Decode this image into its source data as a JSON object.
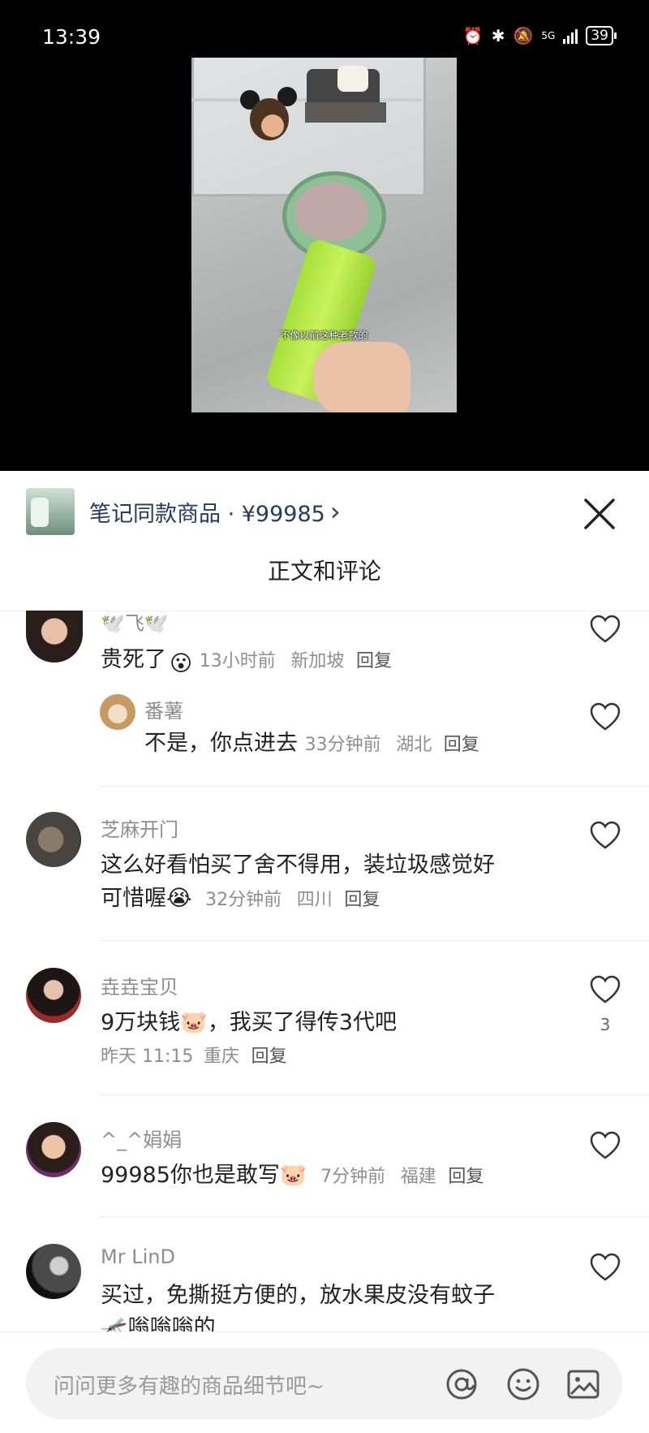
{
  "status_bar": {
    "time": "13:39",
    "battery": "39",
    "network": "5G"
  },
  "video": {
    "subtitle": "不像以前这种老款的"
  },
  "goods_banner": {
    "label": "笔记同款商品 · ¥99985",
    "chevron": "›"
  },
  "sheet": {
    "title": "正文和评论"
  },
  "comments": [
    {
      "name": "🕊️飞🕊️",
      "text": "贵死了",
      "emoji": "😮",
      "time": "13小时前",
      "location": "新加坡",
      "reply": "回复",
      "subreply": {
        "name": "番薯",
        "text": "不是，你点进去",
        "time": "33分钟前",
        "location": "湖北",
        "reply": "回复"
      }
    },
    {
      "name": "芝麻开门",
      "text_line1": "这么好看怕买了舍不得用，装垃圾感觉好",
      "text_line2": "可惜喔",
      "emoji": "😭",
      "time": "32分钟前",
      "location": "四川",
      "reply": "回复"
    },
    {
      "name": "垚垚宝贝",
      "text": "9万块钱",
      "emoji": "🐷",
      "text_after": "，我买了得传3代吧",
      "time": "昨天 11:15",
      "location": "重庆",
      "reply": "回复",
      "likes": "3"
    },
    {
      "name": "^_^娟娟",
      "text": "99985你也是敢写",
      "emoji": "🐷",
      "time": "7分钟前",
      "location": "福建",
      "reply": "回复"
    },
    {
      "name": "Mr LinD",
      "text_line1": "买过，免撕挺方便的，放水果皮没有蚊子",
      "text_line2": "🦟嗡嗡嗡的"
    }
  ],
  "input": {
    "placeholder": "问问更多有趣的商品细节吧~"
  },
  "icons": {
    "mention": "at-icon",
    "emoji": "emoji-icon",
    "image": "image-icon"
  }
}
